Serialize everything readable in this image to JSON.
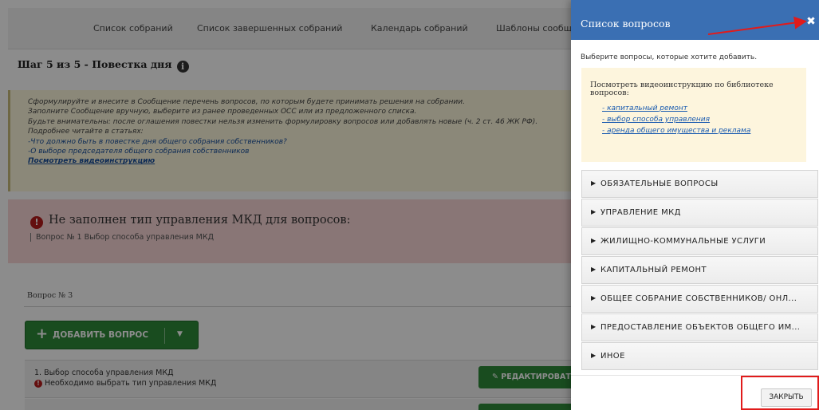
{
  "nav": {
    "items": [
      "Список собраний",
      "Список завершенных собраний",
      "Календарь собраний",
      "Шаблоны сообщ"
    ]
  },
  "step": {
    "title": "Шаг 5 из 5 - Повестка дня",
    "info_icon": "i"
  },
  "hint": {
    "lines": [
      "Сформулируйте и внесите в Сообщение перечень вопросов, по которым будете принимать решения на собрании.",
      "Заполните Сообщение вручную, выберите из ранее проведенных ОСС или из предложенного списка.",
      "Будьте внимательны: после оглашения повестки нельзя изменить формулировку вопросов или добавлять новые (ч. 2 ст. 46 ЖК РФ).",
      "Подробнее читайте в статьях:"
    ],
    "article_links": [
      "-Что должно быть в повестке дня общего собрания собственников?",
      "-О выборе председателя общего собрания собственников"
    ],
    "video_link": "Посмотреть видеоинструкцию"
  },
  "error": {
    "title": "Не заполнен тип управления МКД для вопросов:",
    "detail": "Вопрос № 1 Выбор способа управления МКД"
  },
  "questions": {
    "label": "Вопрос № 3",
    "add_button": "ДОБАВИТЬ ВОПРОС",
    "items": [
      {
        "title": "1. Выбор способа управления МКД",
        "warning": "Необходимо выбрать тип управления МКД",
        "edit_label": "РЕДАКТИРОВАТЬ"
      }
    ]
  },
  "panel": {
    "title": "Список вопросов",
    "subtitle": "Выберите вопросы, которые хотите добавить.",
    "info_text_1": "Посмотреть видеоинструкцию по библиотеке",
    "info_text_2": "вопросов:",
    "info_links": [
      "- капитальный ремонт",
      "- выбор способа управления",
      "- аренда общего имущества и реклама"
    ],
    "categories": [
      "ОБЯЗАТЕЛЬНЫЕ ВОПРОСЫ",
      "УПРАВЛЕНИЕ МКД",
      "ЖИЛИЩНО-КОММУНАЛЬНЫЕ УСЛУГИ",
      "КАПИТАЛЬНЫЙ РЕМОНТ",
      "ОБЩЕЕ СОБРАНИЕ СОБСТВЕННИКОВ/ ОНЛ...",
      "ПРЕДОСТАВЛЕНИЕ ОБЪЕКТОВ ОБЩЕГО ИМ...",
      "ИНОЕ"
    ],
    "close_button": "ЗАКРЫТЬ"
  },
  "icons": {
    "close": "close-icon",
    "info": "info-icon",
    "error": "error-icon",
    "expand": "triangle-right-icon",
    "plus": "plus-icon",
    "dropdown": "caret-down-icon",
    "edit": "pencil-icon"
  },
  "colors": {
    "panel_header": "#3a6fb3",
    "primary_green": "#2e8b3a",
    "error_bg": "#f9d7d7",
    "hint_bg": "#fdf8dc",
    "annotation_red": "#e11b1b"
  }
}
